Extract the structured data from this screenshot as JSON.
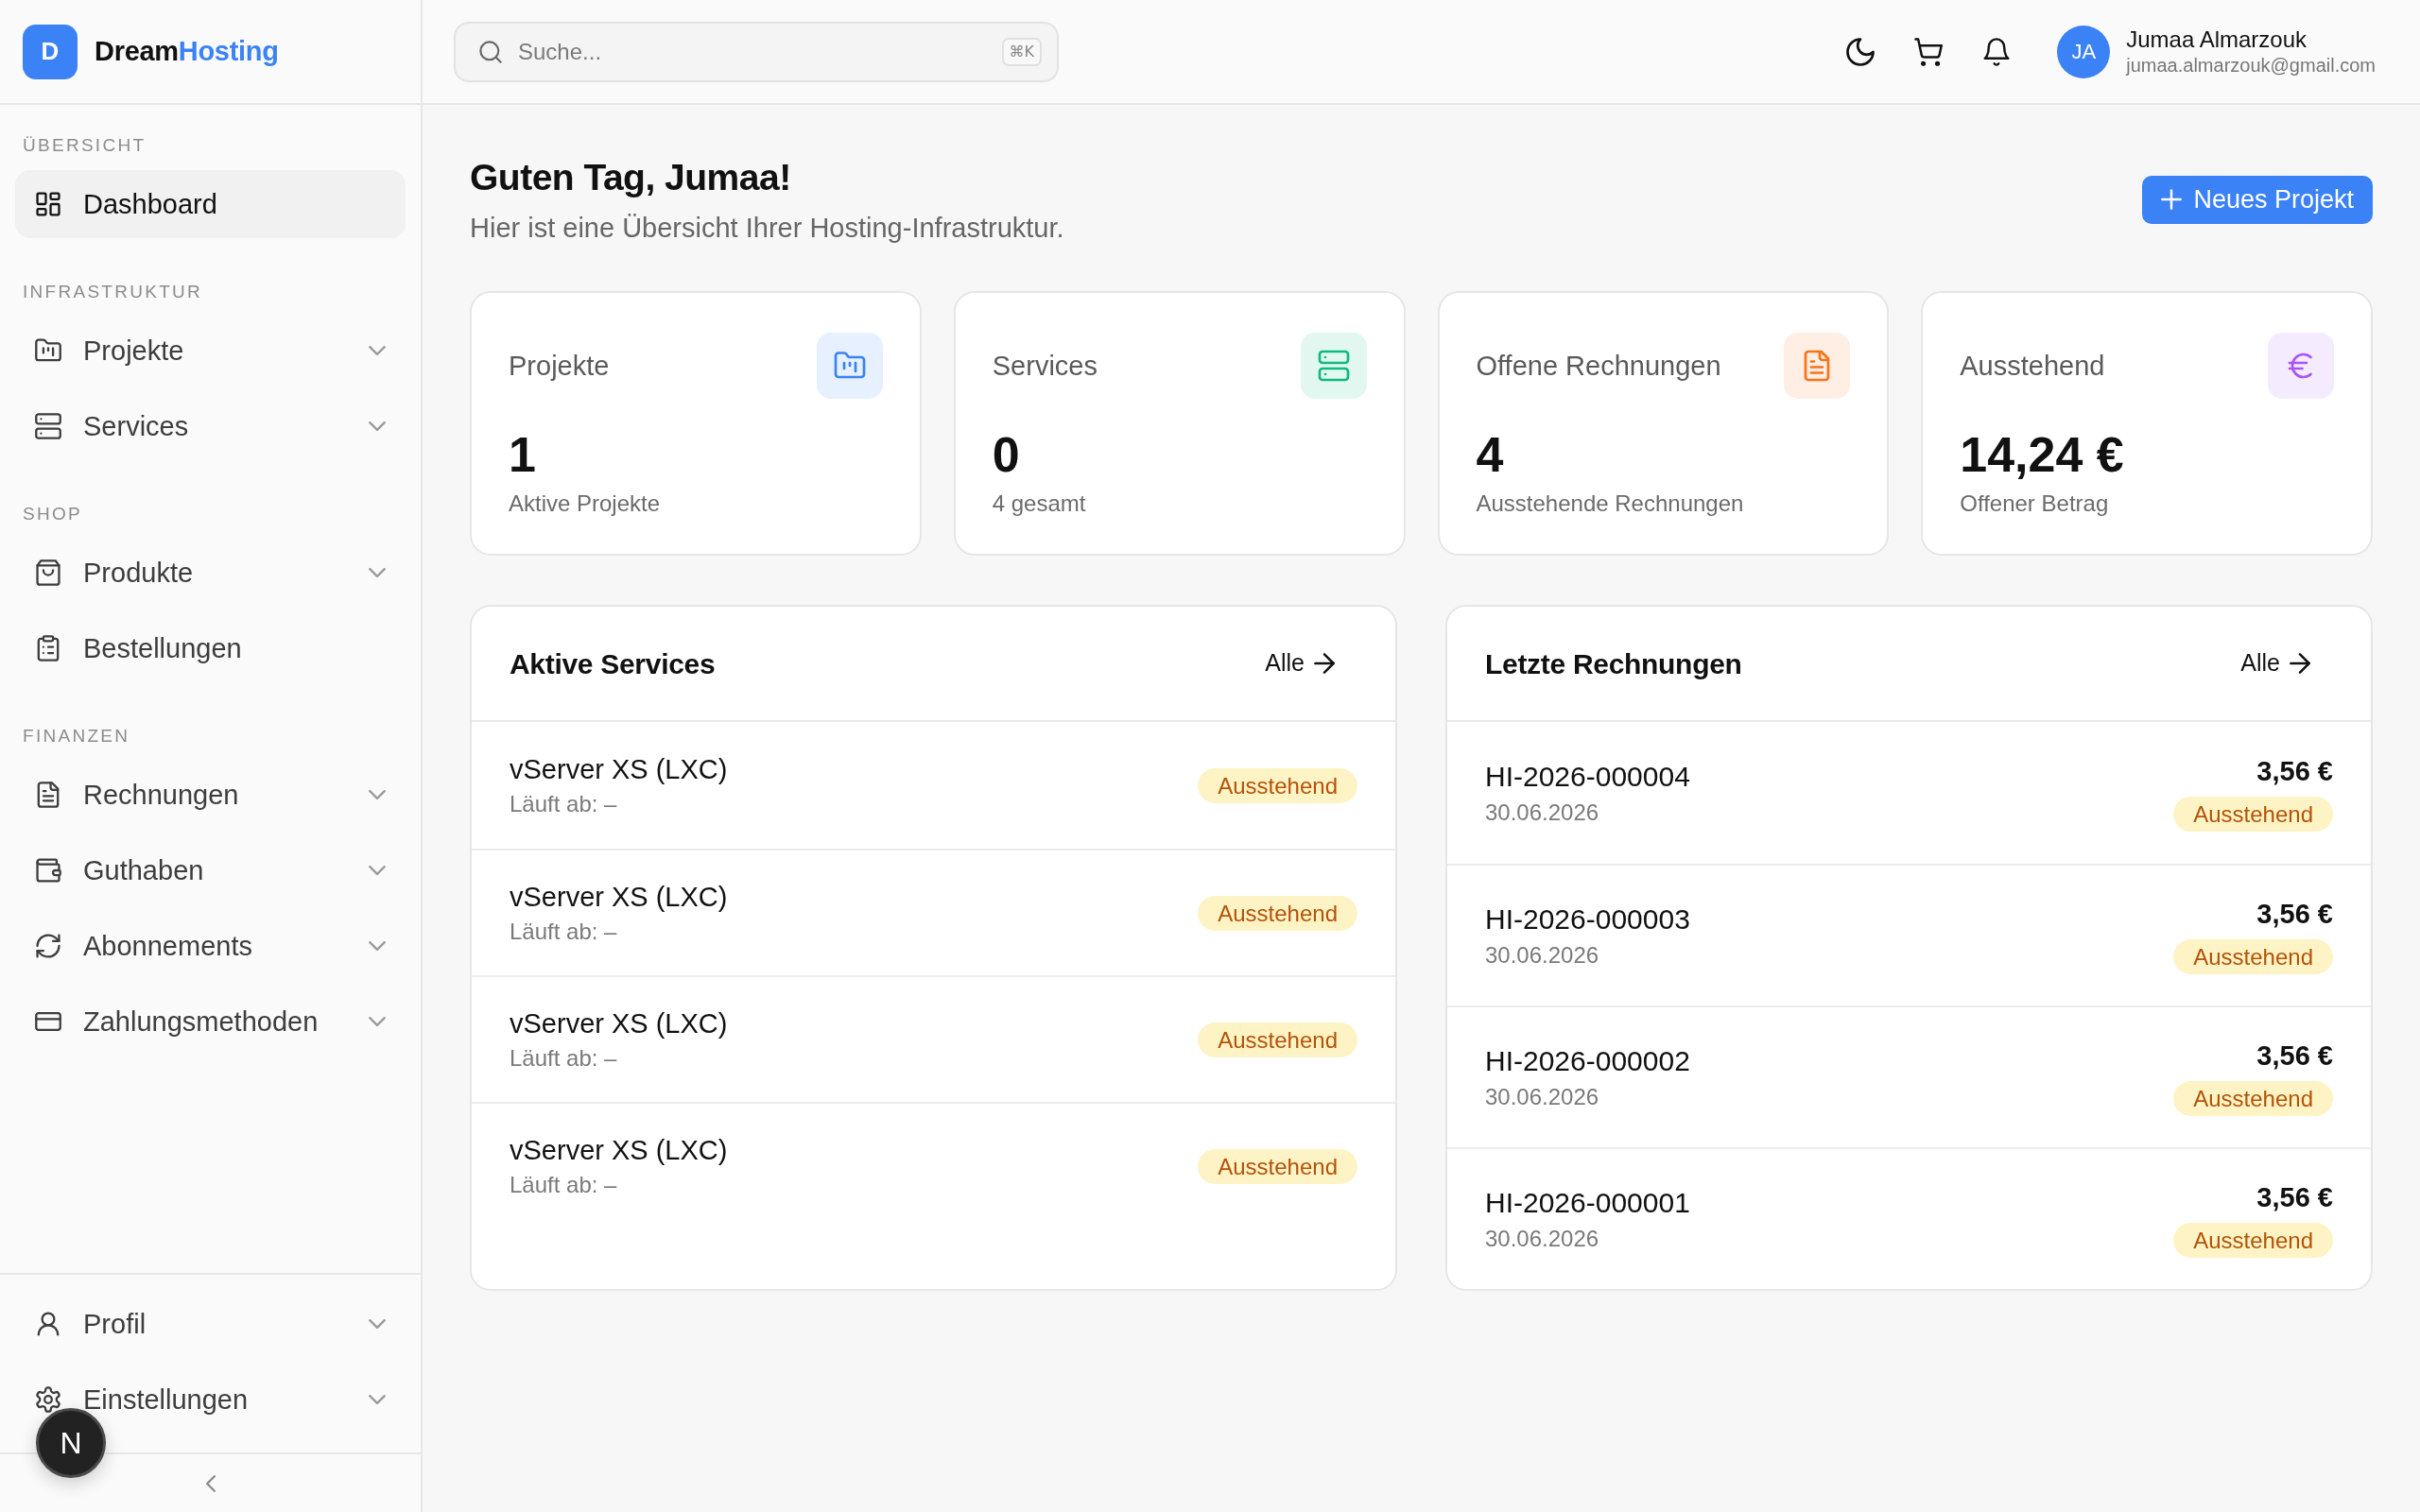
{
  "sidebar": {
    "brand": {
      "initial": "D",
      "name": "Dream",
      "name_accent": "Hosting"
    },
    "sections": [
      {
        "title": "ÜBERSICHT",
        "items": [
          {
            "label": "Dashboard",
            "kind": "link",
            "selected": true
          }
        ]
      },
      {
        "title": "INFRASTRUKTUR",
        "items": [
          {
            "label": "Projekte",
            "kind": "group",
            "selected": false,
            "expanded": false
          },
          {
            "label": "Services",
            "kind": "group",
            "selected": false,
            "expanded": false
          }
        ]
      },
      {
        "title": "SHOP",
        "items": [
          {
            "label": "Produkte",
            "kind": "group",
            "selected": false,
            "expanded": false
          },
          {
            "label": "Bestellungen",
            "kind": "link",
            "selected": false
          }
        ]
      },
      {
        "title": "FINANZEN",
        "items": [
          {
            "label": "Rechnungen",
            "kind": "group",
            "selected": false,
            "expanded": false
          },
          {
            "label": "Guthaben",
            "kind": "group",
            "selected": false,
            "expanded": false
          },
          {
            "label": "Abonnements",
            "kind": "group",
            "selected": false,
            "expanded": false
          },
          {
            "label": "Zahlungsmethoden",
            "kind": "group",
            "selected": false,
            "expanded": false
          }
        ]
      }
    ],
    "footer_items": [
      {
        "label": "Profil",
        "kind": "group",
        "selected": false,
        "expanded": false
      },
      {
        "label": "Einstellungen",
        "kind": "group",
        "selected": false,
        "expanded": false
      }
    ]
  },
  "dev_indicator": {
    "label": "N"
  },
  "topbar": {
    "search": {
      "placeholder": "Suche...",
      "shortcut": "⌘K"
    },
    "user": {
      "initials": "JA",
      "name": "Jumaa Almarzouk",
      "email": "jumaa.almarzouk@gmail.com"
    }
  },
  "page_header": {
    "title": "Guten Tag, Jumaa!",
    "subtitle": "Hier ist eine Übersicht Ihrer Hosting-Infrastruktur.",
    "action": "Neues Projekt"
  },
  "stats": [
    {
      "title": "Projekte",
      "value": "1",
      "caption": "Aktive Projekte",
      "color": "#3b82f6"
    },
    {
      "title": "Services",
      "value": "0",
      "caption": "4 gesamt",
      "color": "#10b981"
    },
    {
      "title": "Offene Rechnungen",
      "value": "4",
      "caption": "Ausstehende Rechnungen",
      "color": "#f97316"
    },
    {
      "title": "Ausstehend",
      "value": "14,24 €",
      "caption": "Offener Betrag",
      "color": "#a855f7"
    }
  ],
  "active_services": {
    "title": "Aktive Services",
    "link": "Alle",
    "rows": [
      {
        "name": "vServer XS (LXC)",
        "expiry": "Läuft ab: –",
        "status": "Ausstehend"
      },
      {
        "name": "vServer XS (LXC)",
        "expiry": "Läuft ab: –",
        "status": "Ausstehend"
      },
      {
        "name": "vServer XS (LXC)",
        "expiry": "Läuft ab: –",
        "status": "Ausstehend"
      },
      {
        "name": "vServer XS (LXC)",
        "expiry": "Läuft ab: –",
        "status": "Ausstehend"
      }
    ]
  },
  "recent_invoices": {
    "title": "Letzte Rechnungen",
    "link": "Alle",
    "rows": [
      {
        "number": "HI-2026-000004",
        "date": "30.06.2026",
        "amount": "3,56 €",
        "status": "Ausstehend"
      },
      {
        "number": "HI-2026-000003",
        "date": "30.06.2026",
        "amount": "3,56 €",
        "status": "Ausstehend"
      },
      {
        "number": "HI-2026-000002",
        "date": "30.06.2026",
        "amount": "3,56 €",
        "status": "Ausstehend"
      },
      {
        "number": "HI-2026-000001",
        "date": "30.06.2026",
        "amount": "3,56 €",
        "status": "Ausstehend"
      }
    ]
  }
}
